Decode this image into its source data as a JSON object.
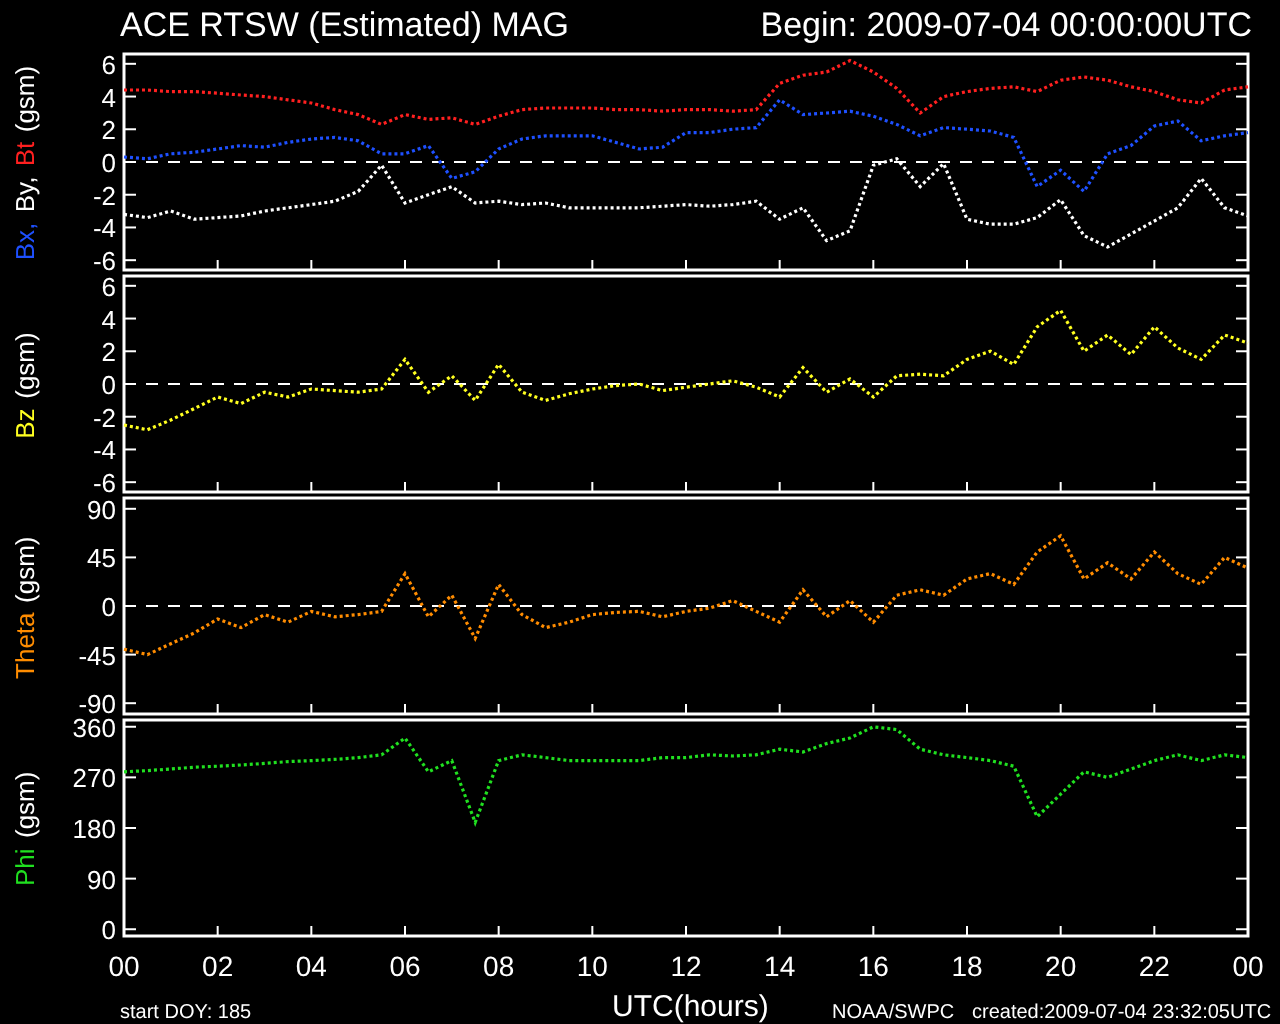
{
  "title": "ACE RTSW (Estimated) MAG",
  "begin": "Begin: 2009-07-04 00:00:00UTC",
  "panels": [
    {
      "ylabel": [
        {
          "text": "Bx,",
          "color": "#1e50ff"
        },
        {
          "text": "By,",
          "color": "#ffffff"
        },
        {
          "text": "Bt",
          "color": "#ff2020"
        },
        {
          "text": "(gsm)",
          "color": "#ffffff"
        }
      ],
      "zero_line": true,
      "chart_data": {
        "type": "line",
        "ylim": [
          -6.6,
          6.6
        ],
        "yticks": [
          {
            "value": -6,
            "label": "-6"
          },
          {
            "value": -4,
            "label": "-4"
          },
          {
            "value": -2,
            "label": "-2"
          },
          {
            "value": 0,
            "label": "0"
          },
          {
            "value": 2,
            "label": "2"
          },
          {
            "value": 4,
            "label": "4"
          },
          {
            "value": 6,
            "label": "6"
          }
        ],
        "categories": [
          null,
          null,
          null,
          null,
          null,
          null,
          null,
          null,
          null,
          null,
          null,
          null,
          null,
          null,
          null,
          null,
          null,
          null,
          null,
          null,
          null,
          null,
          null,
          null,
          null,
          null,
          null,
          null,
          null,
          null,
          null,
          null,
          null,
          null,
          null,
          null,
          null,
          null,
          null,
          null,
          null,
          null,
          null,
          null,
          null,
          null,
          null,
          null,
          null
        ],
        "series": [
          {
            "color": "#ff2020",
            "line_style": "dotted",
            "values": [
              4.4,
              4.4,
              4.3,
              4.3,
              4.2,
              4.1,
              4.0,
              3.8,
              3.6,
              3.2,
              2.9,
              2.3,
              2.9,
              2.6,
              2.7,
              2.3,
              2.8,
              3.2,
              3.3,
              3.3,
              3.3,
              3.2,
              3.2,
              3.1,
              3.2,
              3.2,
              3.1,
              3.2,
              4.8,
              5.3,
              5.5,
              6.2,
              5.5,
              4.5,
              3.0,
              4.0,
              4.3,
              4.5,
              4.6,
              4.3,
              5.0,
              5.2,
              5.0,
              4.6,
              4.3,
              3.8,
              3.6,
              4.4,
              4.6
            ]
          },
          {
            "color": "#1e50ff",
            "line_style": "dotted",
            "values": [
              0.3,
              0.2,
              0.5,
              0.6,
              0.8,
              1.0,
              0.9,
              1.2,
              1.4,
              1.5,
              1.3,
              0.5,
              0.5,
              1.0,
              -1.0,
              -0.6,
              0.8,
              1.4,
              1.6,
              1.6,
              1.6,
              1.2,
              0.8,
              0.9,
              1.8,
              1.8,
              2.0,
              2.1,
              3.8,
              2.9,
              3.0,
              3.1,
              2.8,
              2.3,
              1.6,
              2.1,
              2.0,
              1.9,
              1.5,
              -1.5,
              -0.5,
              -1.8,
              0.5,
              1.0,
              2.2,
              2.5,
              1.3,
              1.6,
              1.8
            ]
          },
          {
            "color": "#ffffff",
            "line_style": "dotted",
            "values": [
              -3.2,
              -3.4,
              -3.0,
              -3.5,
              -3.4,
              -3.3,
              -3.0,
              -2.8,
              -2.6,
              -2.4,
              -1.8,
              -0.2,
              -2.5,
              -2.0,
              -1.5,
              -2.5,
              -2.4,
              -2.6,
              -2.5,
              -2.8,
              -2.8,
              -2.8,
              -2.8,
              -2.7,
              -2.6,
              -2.7,
              -2.6,
              -2.4,
              -3.5,
              -2.8,
              -4.8,
              -4.2,
              -0.2,
              0.2,
              -1.5,
              -0.1,
              -3.5,
              -3.8,
              -3.8,
              -3.4,
              -2.3,
              -4.5,
              -5.2,
              -4.4,
              -3.6,
              -2.8,
              -1.0,
              -2.8,
              -3.3
            ]
          }
        ]
      }
    },
    {
      "ylabel": [
        {
          "text": "Bz",
          "color": "#ffff20"
        },
        {
          "text": "(gsm)",
          "color": "#ffffff"
        }
      ],
      "zero_line": true,
      "chart_data": {
        "type": "line",
        "ylim": [
          -6.6,
          6.6
        ],
        "yticks": [
          {
            "value": -6,
            "label": "-6"
          },
          {
            "value": -4,
            "label": "-4"
          },
          {
            "value": -2,
            "label": "-2"
          },
          {
            "value": 0,
            "label": "0"
          },
          {
            "value": 2,
            "label": "2"
          },
          {
            "value": 4,
            "label": "4"
          },
          {
            "value": 6,
            "label": "6"
          }
        ],
        "categories": [
          null,
          null,
          null,
          null,
          null,
          null,
          null,
          null,
          null,
          null,
          null,
          null,
          null,
          null,
          null,
          null,
          null,
          null,
          null,
          null,
          null,
          null,
          null,
          null,
          null,
          null,
          null,
          null,
          null,
          null,
          null,
          null,
          null,
          null,
          null,
          null,
          null,
          null,
          null,
          null,
          null,
          null,
          null,
          null,
          null,
          null,
          null,
          null,
          null
        ],
        "series": [
          {
            "color": "#ffff20",
            "line_style": "dotted",
            "values": [
              -2.5,
              -2.8,
              -2.2,
              -1.5,
              -0.8,
              -1.2,
              -0.5,
              -0.8,
              -0.3,
              -0.4,
              -0.5,
              -0.3,
              1.5,
              -0.5,
              0.5,
              -1.0,
              1.2,
              -0.5,
              -1.0,
              -0.6,
              -0.3,
              -0.1,
              0.0,
              -0.4,
              -0.2,
              0.0,
              0.2,
              -0.2,
              -0.8,
              1.0,
              -0.5,
              0.3,
              -0.8,
              0.5,
              0.6,
              0.5,
              1.5,
              2.0,
              1.2,
              3.5,
              4.5,
              2.0,
              3.0,
              1.8,
              3.5,
              2.2,
              1.5,
              3.0,
              2.5
            ]
          }
        ]
      }
    },
    {
      "ylabel": [
        {
          "text": "Theta",
          "color": "#ff8c00"
        },
        {
          "text": "(gsm)",
          "color": "#ffffff"
        }
      ],
      "zero_line": true,
      "chart_data": {
        "type": "line",
        "ylim": [
          -100,
          100
        ],
        "yticks": [
          {
            "value": -90,
            "label": "-90"
          },
          {
            "value": -45,
            "label": "-45"
          },
          {
            "value": 0,
            "label": "0"
          },
          {
            "value": 45,
            "label": "45"
          },
          {
            "value": 90,
            "label": "90"
          }
        ],
        "categories": [
          null,
          null,
          null,
          null,
          null,
          null,
          null,
          null,
          null,
          null,
          null,
          null,
          null,
          null,
          null,
          null,
          null,
          null,
          null,
          null,
          null,
          null,
          null,
          null,
          null,
          null,
          null,
          null,
          null,
          null,
          null,
          null,
          null,
          null,
          null,
          null,
          null,
          null,
          null,
          null,
          null,
          null,
          null,
          null,
          null,
          null,
          null,
          null,
          null
        ],
        "series": [
          {
            "color": "#ff8c00",
            "line_style": "dotted",
            "values": [
              -40,
              -45,
              -35,
              -25,
              -12,
              -20,
              -8,
              -15,
              -5,
              -10,
              -8,
              -5,
              30,
              -10,
              10,
              -30,
              20,
              -8,
              -20,
              -15,
              -8,
              -6,
              -5,
              -10,
              -5,
              -2,
              5,
              -5,
              -15,
              15,
              -10,
              5,
              -15,
              10,
              15,
              10,
              25,
              30,
              20,
              50,
              65,
              25,
              40,
              25,
              50,
              30,
              20,
              45,
              35
            ]
          }
        ]
      }
    },
    {
      "ylabel": [
        {
          "text": "Phi",
          "color": "#20e020"
        },
        {
          "text": "(gsm)",
          "color": "#ffffff"
        }
      ],
      "zero_line": false,
      "chart_data": {
        "type": "line",
        "ylim": [
          -12,
          372
        ],
        "yticks": [
          {
            "value": 0,
            "label": "0"
          },
          {
            "value": 90,
            "label": "90"
          },
          {
            "value": 180,
            "label": "180"
          },
          {
            "value": 270,
            "label": "270"
          },
          {
            "value": 360,
            "label": "360"
          }
        ],
        "xlim": [
          0,
          24
        ],
        "xticks": [
          {
            "value": 0,
            "label": "00"
          },
          {
            "value": 2,
            "label": "02"
          },
          {
            "value": 4,
            "label": "04"
          },
          {
            "value": 6,
            "label": "06"
          },
          {
            "value": 8,
            "label": "08"
          },
          {
            "value": 10,
            "label": "10"
          },
          {
            "value": 12,
            "label": "12"
          },
          {
            "value": 14,
            "label": "14"
          },
          {
            "value": 16,
            "label": "16"
          },
          {
            "value": 18,
            "label": "18"
          },
          {
            "value": 20,
            "label": "20"
          },
          {
            "value": 22,
            "label": "22"
          },
          {
            "value": 24,
            "label": "00"
          }
        ],
        "x": [
          0,
          0.5,
          1,
          1.5,
          2,
          2.5,
          3,
          3.5,
          4,
          4.5,
          5,
          5.5,
          6,
          6.5,
          7,
          7.5,
          8,
          8.5,
          9,
          9.5,
          10,
          10.5,
          11,
          11.5,
          12,
          12.5,
          13,
          13.5,
          14,
          14.5,
          15,
          15.5,
          16,
          16.5,
          17,
          17.5,
          18,
          18.5,
          19,
          19.5,
          20,
          20.5,
          21,
          21.5,
          22,
          22.5,
          23,
          23.5,
          24
        ],
        "series": [
          {
            "color": "#20e020",
            "line_style": "dotted",
            "values": [
              280,
              282,
              285,
              288,
              290,
              292,
              295,
              298,
              300,
              302,
              305,
              310,
              340,
              280,
              300,
              190,
              300,
              310,
              305,
              300,
              300,
              300,
              300,
              305,
              305,
              310,
              308,
              310,
              320,
              315,
              330,
              340,
              360,
              355,
              320,
              310,
              305,
              300,
              290,
              200,
              240,
              280,
              270,
              285,
              300,
              310,
              300,
              310,
              305
            ]
          }
        ]
      }
    }
  ],
  "footer": {
    "start": "start DOY:  185",
    "xlabel": "UTC(hours)",
    "source": "NOAA/SWPC",
    "created": "created:2009-07-04 23:32:05UTC"
  }
}
